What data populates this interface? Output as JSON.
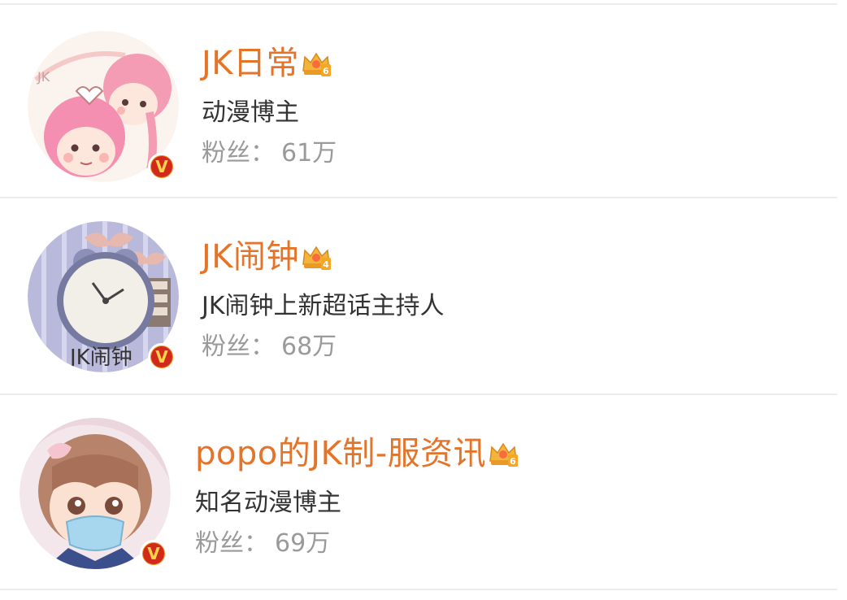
{
  "accounts": [
    {
      "name": "JK日常",
      "crown_level": "6",
      "description": "动漫博主",
      "fans_label": "粉丝：",
      "fans_count": "61万",
      "verified_badge": "V",
      "avatar_icon": "anime-girls-avatar"
    },
    {
      "name": "JK闹钟",
      "crown_level": "4",
      "description": "JK闹钟上新超话主持人",
      "fans_label": "粉丝：",
      "fans_count": "68万",
      "verified_badge": "V",
      "avatar_icon": "alarm-clock-avatar"
    },
    {
      "name": "popo的JK制-服资讯",
      "crown_level": "6",
      "description": "知名动漫博主",
      "fans_label": "粉丝：",
      "fans_count": "69万",
      "verified_badge": "V",
      "avatar_icon": "masked-anime-girl-avatar"
    }
  ],
  "colors": {
    "name": "#e4742a",
    "description": "#333333",
    "fans": "#9a9a9a",
    "badge_outer": "#f08a19",
    "badge_inner": "#d02a1d",
    "divider": "#ececec"
  }
}
